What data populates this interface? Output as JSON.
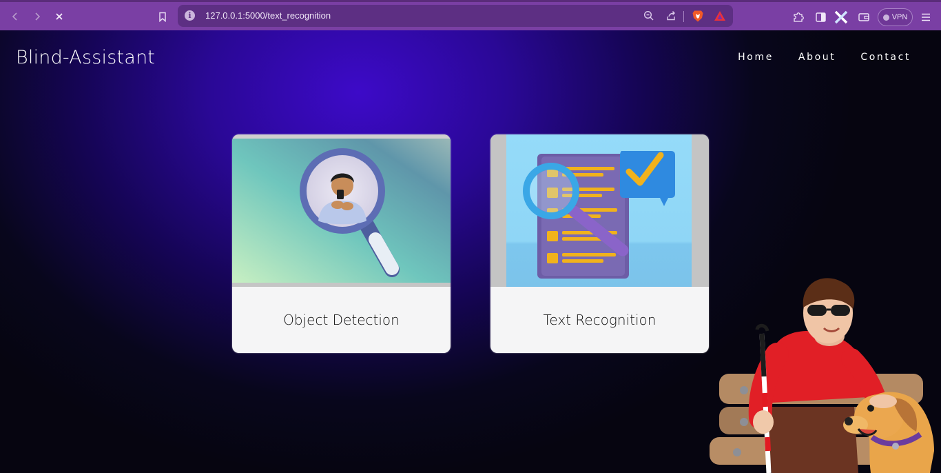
{
  "browser": {
    "url": "127.0.0.1:5000/text_recognition",
    "vpn_label": "VPN",
    "info_glyph": "i",
    "icons": {
      "back": "chevron-left-icon",
      "forward": "chevron-right-icon",
      "stop": "close-icon",
      "bookmark": "bookmark-icon",
      "zoom": "zoom-icon",
      "share": "share-icon",
      "brave": "brave-shields-icon",
      "rewards": "brave-rewards-icon",
      "extensions": "puzzle-icon",
      "sidebar": "sidebar-icon",
      "wallet": "wallet-icon",
      "menu": "hamburger-menu-icon"
    },
    "colors": {
      "toolbar": "#7a3fa4",
      "urlbar": "#5d2f83"
    }
  },
  "site": {
    "brand": "Blind-Assistant",
    "nav": [
      "Home",
      "About",
      "Contact"
    ]
  },
  "cards": [
    {
      "title": "Object Detection",
      "image": "magnifier-person-illustration"
    },
    {
      "title": "Text Recognition",
      "image": "document-magnifier-checkmark-illustration"
    }
  ],
  "decor": {
    "mascot": "blind-person-with-cane-and-guide-dog-on-bench"
  },
  "colors": {
    "page_glow": "#3d0ac8",
    "page_dark": "#07061a",
    "card_bg": "#f5f5f6"
  }
}
